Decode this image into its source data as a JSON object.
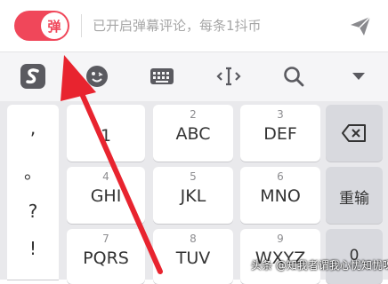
{
  "comment_bar": {
    "toggle_label": "弹",
    "input_placeholder": "已开启弹幕评论，每条1抖币"
  },
  "toolbar": {
    "icons": [
      "sogou-logo-icon",
      "emoji-icon",
      "keyboard-icon",
      "cursor-move-icon",
      "search-icon",
      "collapse-icon"
    ]
  },
  "punctuation": [
    ",",
    "。",
    "?",
    "!"
  ],
  "keys": {
    "k2": {
      "num": "2",
      "letters": "ABC"
    },
    "k3": {
      "num": "3",
      "letters": "DEF"
    },
    "k4": {
      "num": "4",
      "letters": "GHI"
    },
    "k5": {
      "num": "5",
      "letters": "JKL"
    },
    "k6": {
      "num": "6",
      "letters": "MNO"
    },
    "k7": {
      "num": "7",
      "letters": "PQRS"
    },
    "k8": {
      "num": "8",
      "letters": "TUV"
    },
    "k9": {
      "num": "9",
      "letters": "WXYZ"
    },
    "k1_label": "1",
    "reinput_label": "重输",
    "zero_label": "0"
  },
  "watermark": "头条 @知我者谓我心忧知忧呀",
  "colors": {
    "accent": "#f0475a",
    "annotation_arrow": "#e8242f"
  }
}
